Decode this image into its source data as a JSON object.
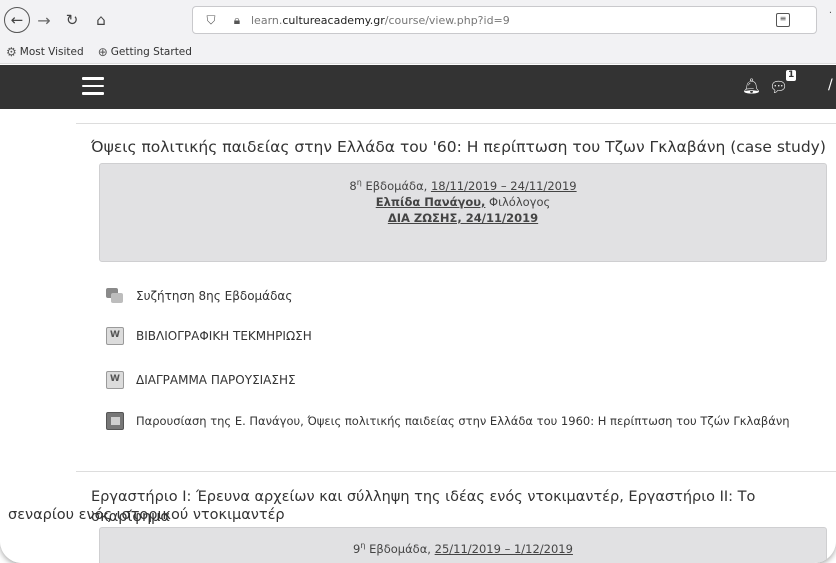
{
  "browser": {
    "url_prefix": "learn.",
    "url_domain": "cultureacademy.gr",
    "url_path": "/course/view.php?id=9",
    "bookmarks": [
      {
        "label": "Most Visited",
        "icon": "gear-icon"
      },
      {
        "label": "Getting Started",
        "icon": "globe-icon"
      }
    ]
  },
  "header": {
    "menu_icon": "hamburger-icon",
    "notifications_icon": "bell-icon",
    "messages_icon": "chat-icon",
    "messages_count": "1"
  },
  "sections": [
    {
      "title": "Όψεις πολιτικής παιδείας στην Ελλάδα του '60: Η περίπτωση του Τζων Γκλαβάνη (case study)",
      "summary": {
        "week_prefix": "8",
        "week_sup": "η",
        "week_label": " Εβδομάδα, ",
        "dates": "18/11/2019 – 24/11/2019",
        "instructor": "Ελπίδα Πανάγου,",
        "role": " Φιλόλογος",
        "live": "ΔΙΑ ΖΩΣΗΣ, 24/11/2019"
      },
      "activities": [
        {
          "label": "Συζήτηση 8ης Εβδομάδας",
          "icon": "forum-icon"
        },
        {
          "label": "ΒΙΒΛΙΟΓΡΑΦΙΚΗ ΤΕΚΜΗΡΙΩΣΗ",
          "icon": "document-icon"
        },
        {
          "label": "ΔΙΑΓΡΑΜΜΑ ΠΑΡΟΥΣΙΑΣΗΣ",
          "icon": "document-icon"
        },
        {
          "label": "Παρουσίαση της Ε. Πανάγου, Όψεις πολιτικής παιδείας στην Ελλάδα του 1960: Η περίπτωση του Τζών Γκλαβάνη",
          "icon": "presentation-icon"
        }
      ]
    },
    {
      "title_line1": "Εργαστήριο Ι: Έρευνα αρχείων και σύλληψη της ιδέας ενός ντοκιμαντέρ, Εργαστήριο ΙΙ: Το σκαρίφημα",
      "title_line2": "σεναρίου ενός ιστορικού ντοκιμαντέρ",
      "summary": {
        "week_prefix": "9",
        "week_sup": "η",
        "week_label": " Εβδομάδα, ",
        "dates": "25/11/2019 – 1/12/2019"
      }
    }
  ]
}
